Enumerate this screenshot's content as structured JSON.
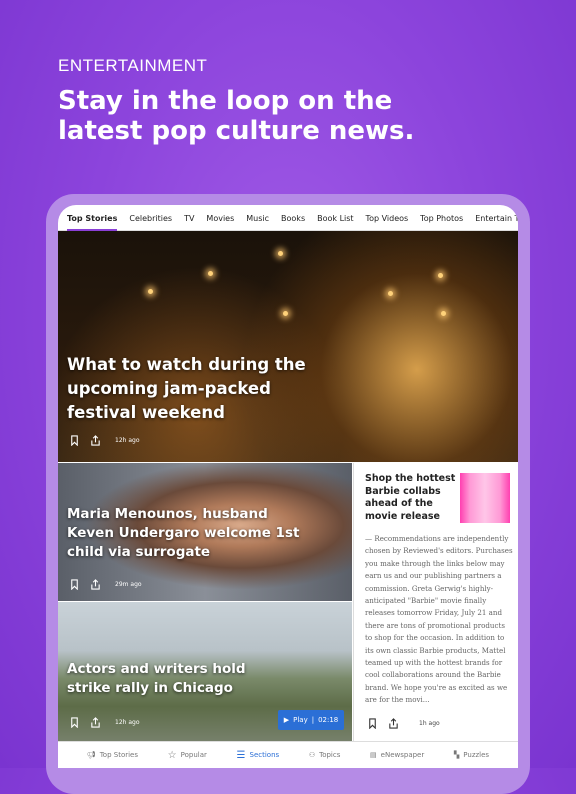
{
  "promo": {
    "kicker": "ENTERTAINMENT",
    "headline": "Stay in the loop on the latest pop culture news."
  },
  "tabs": [
    "Top Stories",
    "Celebrities",
    "TV",
    "Movies",
    "Music",
    "Books",
    "Book List",
    "Top Videos",
    "Top Photos",
    "Entertain This!"
  ],
  "stories": [
    {
      "title": "What to watch during the upcoming jam-packed festival weekend",
      "time": "12h ago"
    },
    {
      "title": "Maria Menounos, husband Keven Undergaro welcome 1st child via surrogate",
      "time": "29m ago"
    },
    {
      "title": "Actors and writers hold strike rally in Chicago",
      "time": "12h ago",
      "play_label": "Play",
      "duration": "02:18"
    }
  ],
  "side_story": {
    "title": "Shop the hottest Barbie collabs ahead of the movie release",
    "body": "— Recommendations are independently chosen by Reviewed's editors. Purchases you make through the links below may earn us and our publishing partners a commission. Greta Gerwig's highly-anticipated \"Barbie\" movie finally releases tomorrow Friday, July 21 and there are tons of promotional products to shop for the occasion. In addition to its own classic Barbie products, Mattel teamed up with the hottest brands for cool collaborations around the Barbie brand.  We hope you're as excited as we are for the movi...",
    "time": "1h ago"
  },
  "bottom_nav": [
    {
      "label": "Top Stories",
      "icon": "megaphone-icon"
    },
    {
      "label": "Popular",
      "icon": "star-icon"
    },
    {
      "label": "Sections",
      "icon": "list-icon",
      "active": true
    },
    {
      "label": "Topics",
      "icon": "topics-icon"
    },
    {
      "label": "eNewspaper",
      "icon": "newspaper-icon"
    },
    {
      "label": "Puzzles",
      "icon": "puzzle-icon"
    }
  ],
  "colors": {
    "accent": "#8a3fd6",
    "active_nav": "#2b6fd6"
  }
}
